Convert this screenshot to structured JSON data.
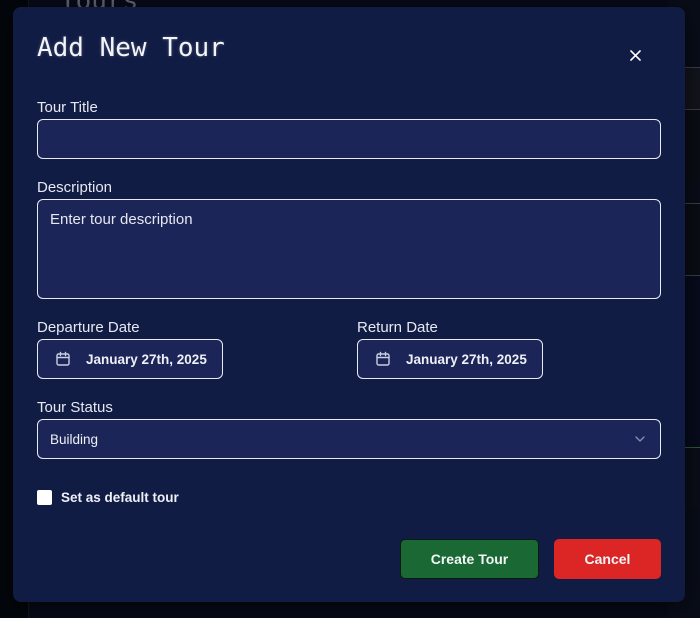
{
  "background": {
    "page_heading": "Tours"
  },
  "modal": {
    "title": "Add New Tour",
    "close_icon": "close-icon",
    "fields": {
      "tour_title": {
        "label": "Tour Title",
        "value": "",
        "placeholder": ""
      },
      "description": {
        "label": "Description",
        "value": "",
        "placeholder": "Enter tour description"
      },
      "departure_date": {
        "label": "Departure Date",
        "value": "January 27th, 2025",
        "icon": "calendar-icon"
      },
      "return_date": {
        "label": "Return Date",
        "value": "January 27th, 2025",
        "icon": "calendar-icon"
      },
      "tour_status": {
        "label": "Tour Status",
        "selected": "Building",
        "icon": "chevron-down-icon"
      },
      "default_tour": {
        "label": "Set as default tour",
        "checked": false
      }
    },
    "buttons": {
      "create": "Create Tour",
      "cancel": "Cancel"
    },
    "colors": {
      "modal_bg": "#111c45",
      "input_bg": "#1c2558",
      "create_button": "#1a6834",
      "cancel_button": "#dc2626"
    }
  }
}
